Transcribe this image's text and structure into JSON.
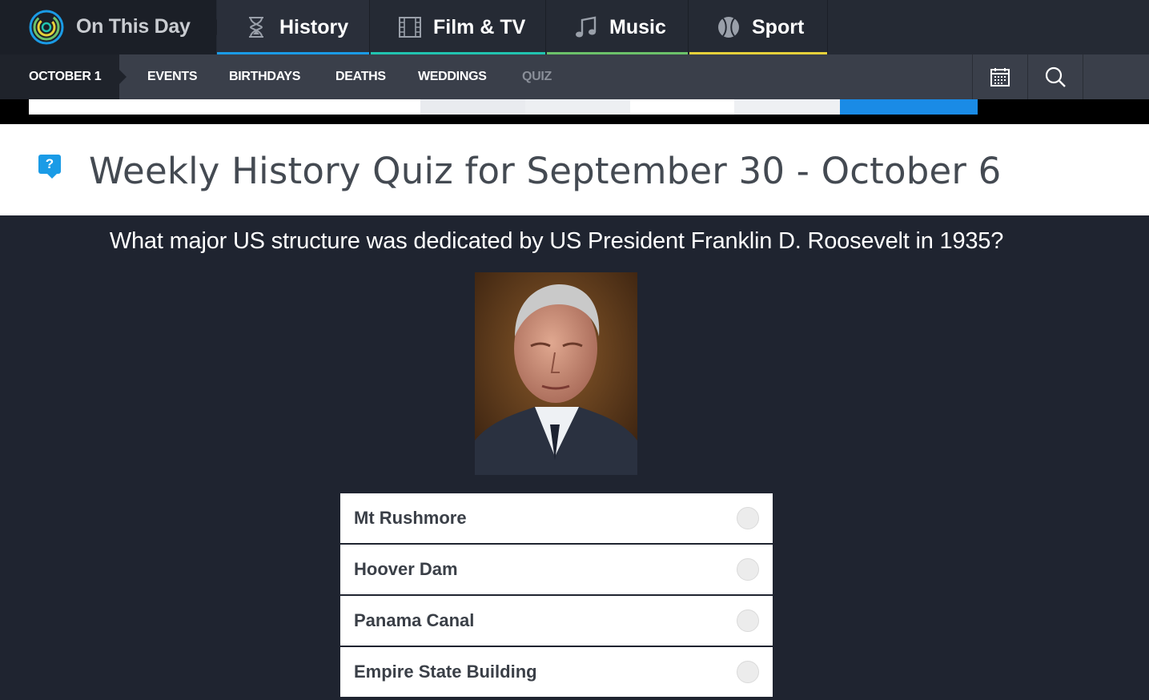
{
  "brand": {
    "name": "On This Day"
  },
  "categories": [
    {
      "label": "History",
      "icon": "hourglass-icon",
      "color": "#1a9be6"
    },
    {
      "label": "Film & TV",
      "icon": "film-icon",
      "color": "#21c4b0"
    },
    {
      "label": "Music",
      "icon": "music-note-icon",
      "color": "#6cc26a"
    },
    {
      "label": "Sport",
      "icon": "ball-icon",
      "color": "#e6d13a"
    }
  ],
  "subnav": {
    "date": "OCTOBER 1",
    "links": [
      "EVENTS",
      "BIRTHDAYS",
      "DEATHS",
      "WEDDINGS",
      "QUIZ"
    ],
    "calendar_icon": "calendar-icon",
    "search_icon": "search-icon"
  },
  "page": {
    "title": "Weekly History Quiz for September 30 - October 6",
    "badge_icon": "question-badge-icon",
    "badge_text": "?"
  },
  "quiz": {
    "question": "What major US structure was dedicated by US President Franklin D. Roosevelt in 1935?",
    "image_icon": "portrait-roosevelt",
    "options": [
      "Mt Rushmore",
      "Hoover Dam",
      "Panama Canal",
      "Empire State Building"
    ]
  }
}
